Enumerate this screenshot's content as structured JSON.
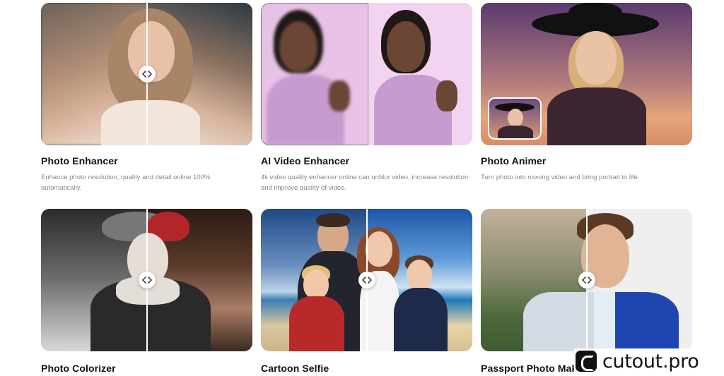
{
  "colors": {
    "brand": "#111111",
    "title": "#111111",
    "description": "#888888"
  },
  "icons": {
    "compare_handle": "chevron-left-right-icon",
    "brand_logo": "cutout-c-logo-icon"
  },
  "tools": [
    {
      "title": "Photo Enhancer",
      "description": "Enhance photo resolution, quality and detail online 100% automatically."
    },
    {
      "title": "AI Video Enhancer",
      "description": "4k video quality enhancer online can unblur video, increase resolution and improve quality of video."
    },
    {
      "title": "Photo Animer",
      "description": "Turn photo into moving video and bring portrait to life."
    },
    {
      "title": "Photo Colorizer",
      "description": ""
    },
    {
      "title": "Cartoon Selfie",
      "description": ""
    },
    {
      "title": "Passport Photo Maker",
      "description": ""
    }
  ],
  "brand": {
    "text": "cutout.pro"
  }
}
